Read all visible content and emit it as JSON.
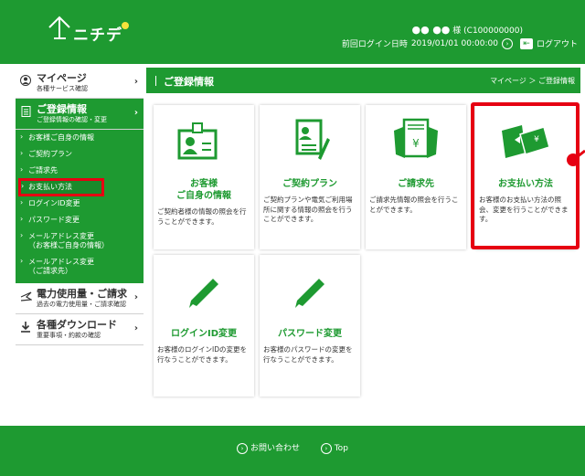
{
  "header": {
    "logo_text": "ニチデ",
    "user_dots": "●● ●●",
    "user_suffix": "様",
    "customer_id": "(C100000000)",
    "last_login_label": "前回ログイン日時",
    "last_login_time": "2019/01/01 00:00:00",
    "logout_label": "ログアウト"
  },
  "sidebar": {
    "mypage": {
      "title": "マイページ",
      "sub": "各種サービス確認"
    },
    "registration": {
      "title": "ご登録情報",
      "sub": "ご登録情報の確認・変更"
    },
    "items": [
      "お客様ご自身の情報",
      "ご契約プラン",
      "ご請求先",
      "お支払い方法",
      "ログインID変更",
      "パスワード変更",
      "メールアドレス変更\n（お客様ご自身の情報）",
      "メールアドレス変更\n（ご請求先）"
    ],
    "usage": {
      "title": "電力使用量・ご請求",
      "sub": "過去の電力使用量・ご請求確認"
    },
    "download": {
      "title": "各種ダウンロード",
      "sub": "重要事項・約款の確認"
    }
  },
  "main": {
    "title": "ご登録情報",
    "breadcrumb": "マイページ ＞ ご登録情報",
    "cards": [
      {
        "title": "お客様\nご自身の情報",
        "desc": "ご契約者様の情報の照会を行うことができます。",
        "icon": "id-card-icon"
      },
      {
        "title": "ご契約プラン",
        "desc": "ご契約プランや電気ご利用場所に関する情報の照会を行うことができます。",
        "icon": "contract-document-icon"
      },
      {
        "title": "ご請求先",
        "desc": "ご請求先情報の照会を行うことができます。",
        "icon": "invoice-icon"
      },
      {
        "title": "お支払い方法",
        "desc": "お客様のお支払い方法の照会、変更を行うことができます。",
        "icon": "payment-money-icon"
      },
      {
        "title": "ログインID変更",
        "desc": "お客様のログインIDの変更を行なうことができます。",
        "icon": "pencil-icon"
      },
      {
        "title": "パスワード変更",
        "desc": "お客様のパスワードの変更を行なうことができます。",
        "icon": "pencil-icon"
      }
    ]
  },
  "footer": {
    "contact": "お問い合わせ",
    "top": "Top"
  },
  "colors": {
    "brand_green": "#1e9a31",
    "highlight_red": "#e60012"
  }
}
